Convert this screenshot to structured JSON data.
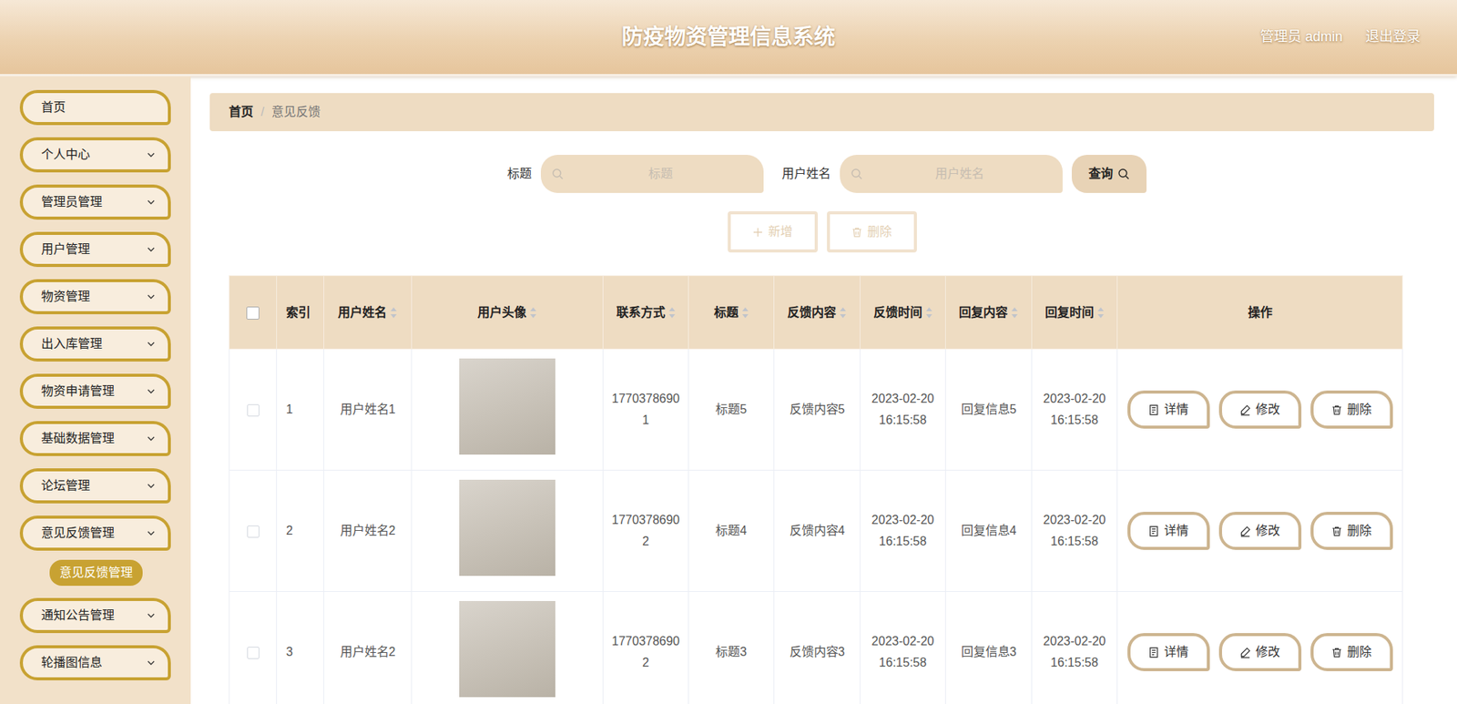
{
  "window": {
    "title": "防疫物资管理信息系统"
  },
  "header": {
    "user": "管理员 admin",
    "logout": "退出登录"
  },
  "sidebar": {
    "items": [
      {
        "label": "首页",
        "expandable": false,
        "expanded": false,
        "children": []
      },
      {
        "label": "个人中心",
        "expandable": true,
        "expanded": false,
        "children": []
      },
      {
        "label": "管理员管理",
        "expandable": true,
        "expanded": false,
        "children": []
      },
      {
        "label": "用户管理",
        "expandable": true,
        "expanded": false,
        "children": []
      },
      {
        "label": "物资管理",
        "expandable": true,
        "expanded": false,
        "children": []
      },
      {
        "label": "出入库管理",
        "expandable": true,
        "expanded": false,
        "children": []
      },
      {
        "label": "物资申请管理",
        "expandable": true,
        "expanded": false,
        "children": []
      },
      {
        "label": "基础数据管理",
        "expandable": true,
        "expanded": false,
        "children": []
      },
      {
        "label": "论坛管理",
        "expandable": true,
        "expanded": false,
        "children": []
      },
      {
        "label": "意见反馈管理",
        "expandable": true,
        "expanded": true,
        "children": [
          {
            "label": "意见反馈管理",
            "selected": true
          }
        ]
      },
      {
        "label": "通知公告管理",
        "expandable": true,
        "expanded": false,
        "children": []
      },
      {
        "label": "轮播图信息",
        "expandable": true,
        "expanded": false,
        "children": []
      }
    ]
  },
  "breadcrumb": {
    "separator": "/",
    "items": [
      {
        "label": "首页",
        "current": false
      },
      {
        "label": "意见反馈",
        "current": true
      }
    ]
  },
  "search": {
    "fields": [
      {
        "label": "标题",
        "placeholder": "标题"
      },
      {
        "label": "用户姓名",
        "placeholder": "用户姓名"
      }
    ],
    "button": "查询"
  },
  "actions": [
    {
      "label": "新增",
      "kind": "add",
      "disabled": true
    },
    {
      "label": "删除",
      "kind": "delete",
      "disabled": true
    }
  ],
  "table": {
    "header_checked": false,
    "columns": [
      {
        "key": "index",
        "label": "索引",
        "sortable": false
      },
      {
        "key": "name",
        "label": "用户姓名",
        "sortable": true
      },
      {
        "key": "avatar",
        "label": "用户头像",
        "sortable": true
      },
      {
        "key": "phone",
        "label": "联系方式",
        "sortable": true
      },
      {
        "key": "title",
        "label": "标题",
        "sortable": true
      },
      {
        "key": "content",
        "label": "反馈内容",
        "sortable": true
      },
      {
        "key": "time",
        "label": "反馈时间",
        "sortable": true
      },
      {
        "key": "reply",
        "label": "回复内容",
        "sortable": true
      },
      {
        "key": "reply_time",
        "label": "回复时间",
        "sortable": true
      },
      {
        "key": "actions",
        "label": "操作",
        "sortable": false
      }
    ],
    "rows": [
      {
        "checked": false,
        "index": "1",
        "name": "用户姓名1",
        "phone": "17703786901",
        "title": "标题5",
        "content": "反馈内容5",
        "time": "2023-02-20 16:15:58",
        "reply": "回复信息5",
        "reply_time": "2023-02-20 16:15:58"
      },
      {
        "checked": false,
        "index": "2",
        "name": "用户姓名2",
        "phone": "17703786902",
        "title": "标题4",
        "content": "反馈内容4",
        "time": "2023-02-20 16:15:58",
        "reply": "回复信息4",
        "reply_time": "2023-02-20 16:15:58"
      },
      {
        "checked": false,
        "index": "3",
        "name": "用户姓名2",
        "phone": "17703786902",
        "title": "标题3",
        "content": "反馈内容3",
        "time": "2023-02-20 16:15:58",
        "reply": "回复信息3",
        "reply_time": "2023-02-20 16:15:58"
      }
    ],
    "row_actions": [
      {
        "label": "详情",
        "kind": "detail"
      },
      {
        "label": "修改",
        "kind": "edit"
      },
      {
        "label": "删除",
        "kind": "delete"
      }
    ]
  }
}
